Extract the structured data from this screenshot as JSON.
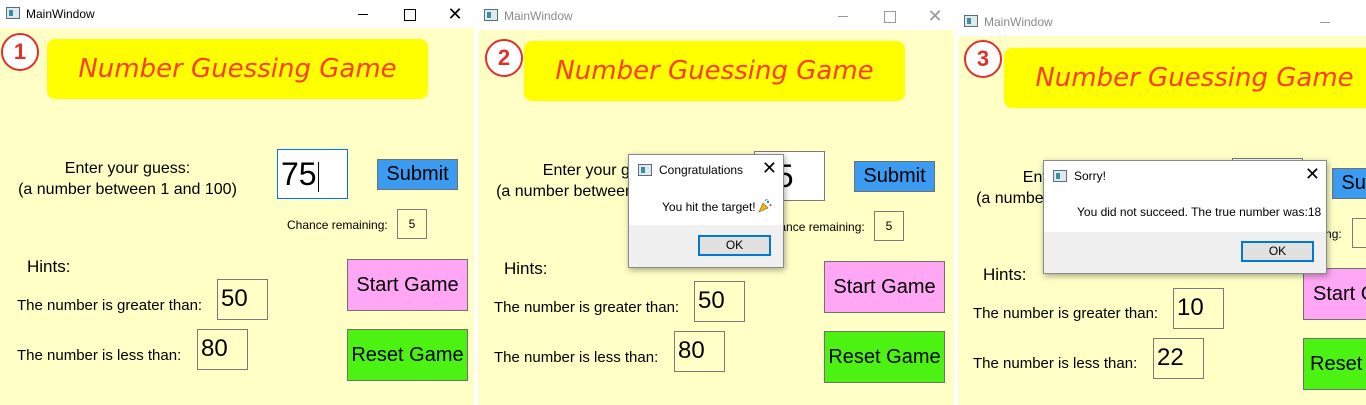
{
  "window_title": "MainWindow",
  "title_buttons": {
    "close": "✕"
  },
  "game_title": "Number Guessing Game",
  "prompt_line1": "Enter your guess:",
  "prompt_line2": "(a number between 1 and 100)",
  "submit_label": "Submit",
  "chance_label": "Chance remaining:",
  "hints_label": "Hints:",
  "greater_label": "The number is greater than:",
  "less_label": "The number is less than:",
  "start_label": "Start Game",
  "reset_label": "Reset Game",
  "panels": [
    {
      "step": "1",
      "guess": "75",
      "chances": "5",
      "greater": "50",
      "less": "80"
    },
    {
      "step": "2",
      "guess": "75",
      "chances": "5",
      "greater": "50",
      "less": "80",
      "dialog": {
        "title": "Congratulations",
        "message": "You hit the target!",
        "ok": "OK",
        "icon": "party-popper-icon"
      }
    },
    {
      "step": "3",
      "guess": "",
      "chances": "",
      "greater": "10",
      "less": "22",
      "dialog": {
        "title": "Sorry!",
        "message": "You did not succeed. The true number was:18",
        "ok": "OK"
      }
    }
  ],
  "colors": {
    "window_bg": "#ffffc6",
    "banner_bg": "#ffff00",
    "banner_text": "#ff3c1f",
    "submit_bg": "#3a9bf0",
    "start_bg": "#ffa6f4",
    "reset_bg": "#4cf312",
    "step_marker": "#e0302a"
  }
}
